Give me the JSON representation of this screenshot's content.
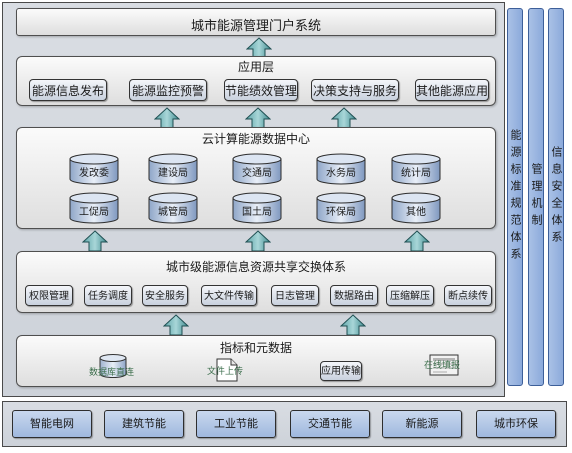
{
  "portal": {
    "title": "城市能源管理门户系统"
  },
  "application_layer": {
    "title": "应用层",
    "items": [
      "能源信息发布",
      "能源监控预警",
      "节能绩效管理",
      "决策支持与服务",
      "其他能源应用"
    ]
  },
  "cloud_center": {
    "title": "云计算能源数据中心",
    "row1": [
      "发改委",
      "建设局",
      "交通局",
      "水务局",
      "统计局"
    ],
    "row2": [
      "工促局",
      "城管局",
      "国土局",
      "环保局",
      "其他"
    ]
  },
  "exchange_system": {
    "title": "城市级能源信息资源共享交换体系",
    "items": [
      "权限管理",
      "任务调度",
      "安全服务",
      "大文件传输",
      "日志管理",
      "数据路由",
      "压缩解压",
      "断点续传"
    ]
  },
  "metadata_layer": {
    "title": "指标和元数据",
    "db_label": "数据库直连",
    "file_label": "文件上传",
    "app_label": "应用传输",
    "online_label": "在线填报"
  },
  "side_bars": [
    "能源标准规范体系",
    "管理机制",
    "信息安全体系"
  ],
  "bottom_items": [
    "智能电网",
    "建筑节能",
    "工业节能",
    "交通节能",
    "新能源",
    "城市环保"
  ]
}
